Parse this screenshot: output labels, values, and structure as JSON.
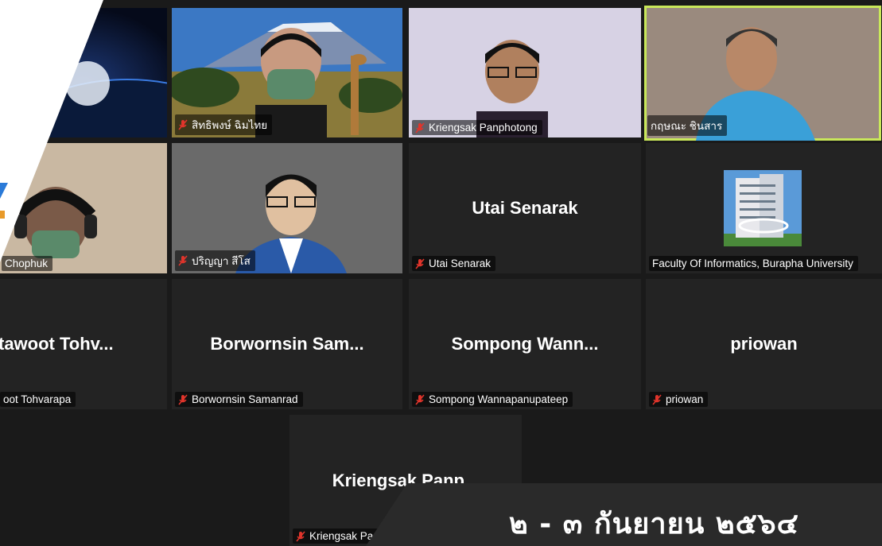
{
  "participants": [
    {
      "display": "สิทธิพงษ์ ฉิมไทย",
      "muted": true
    },
    {
      "display": "Kriengsak Panphotong",
      "muted": true
    },
    {
      "display": "กฤษณะ ชินสาร",
      "muted": false
    },
    {
      "display": "Chophuk",
      "muted": true
    },
    {
      "display": "ปริญญา สีโส",
      "muted": true
    },
    {
      "center": "Utai Senarak",
      "display": "Utai Senarak",
      "muted": true
    },
    {
      "display": "Faculty Of Informatics, Burapha University",
      "muted": false
    },
    {
      "center": "tawoot  Tohv...",
      "display": "oot Tohvarapa",
      "muted": false
    },
    {
      "center": "Borwornsin  Sam...",
      "display": "Borwornsin Samanrad",
      "muted": true
    },
    {
      "center": "Sompong  Wann...",
      "display": "Sompong Wannapanupateep",
      "muted": true
    },
    {
      "center": "priowan",
      "display": "priowan",
      "muted": true
    },
    {
      "center": "Kriengsak  Panp...",
      "display": "Kriengsak Panphotong",
      "muted": true
    }
  ],
  "overlay": {
    "date_text": "๒ - ๓ กันยายน ๒๕๖๔"
  },
  "colors": {
    "active_speaker_border": "#c9e85a",
    "muted_icon": "#e0342b",
    "tile_bg": "#232323",
    "gallery_bg": "#1a1a1a"
  }
}
